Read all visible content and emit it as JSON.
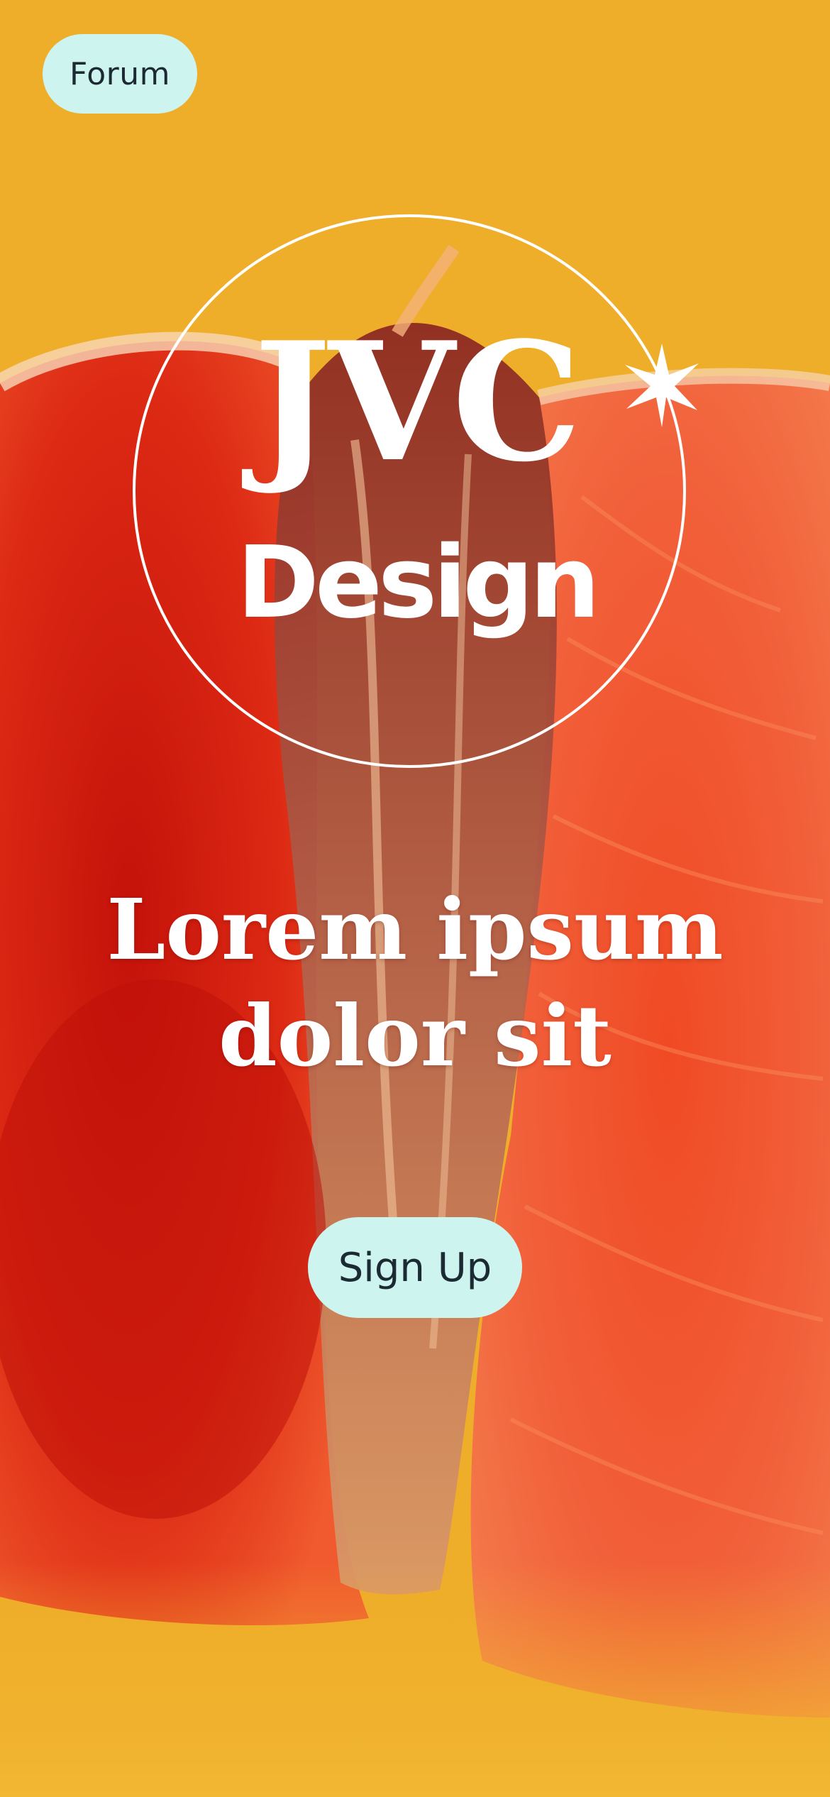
{
  "nav": {
    "forum_label": "Forum"
  },
  "logo": {
    "line1": "JVC",
    "line2": "Design",
    "icon": "sparkle-icon"
  },
  "hero": {
    "headline_line1": "Lorem ipsum",
    "headline_line2": "dolor sit",
    "background": "grapefruit-photo"
  },
  "cta": {
    "signup_label": "Sign Up"
  },
  "colors": {
    "background": "#efae2a",
    "button_bg": "#cdf4ee",
    "button_text": "#1c2a33",
    "fruit_red": "#e0301b",
    "text_light": "#ffffff"
  }
}
